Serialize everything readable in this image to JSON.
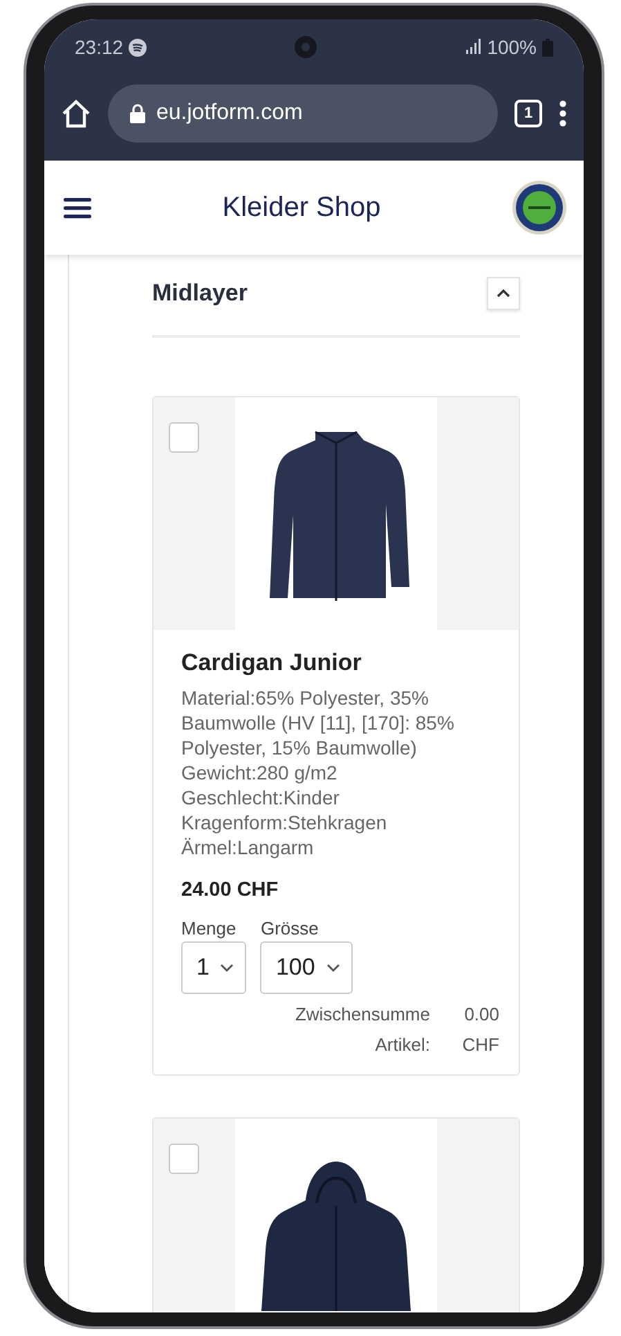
{
  "status_bar": {
    "time": "23:12",
    "battery": "100%"
  },
  "browser": {
    "url": "eu.jotform.com",
    "tab_count": "1"
  },
  "header": {
    "title": "Kleider Shop"
  },
  "section": {
    "title": "Midlayer",
    "expanded": true
  },
  "products": [
    {
      "kind": "cardigan",
      "selected": false,
      "name": "Cardigan Junior",
      "description": "Material:65% Polyester, 35% Baumwolle (HV [11], [170]: 85% Polyester, 15% Baumwolle) Gewicht:280 g/m2 Geschlecht:Kinder Kragenform:Stehkragen Ärmel:Langarm",
      "price": "24.00 CHF",
      "quantity_label": "Menge",
      "quantity": "1",
      "size_label": "Grösse",
      "size": "100",
      "subtotal_label": "Zwischensumme Artikel:",
      "subtotal": "0.00 CHF"
    },
    {
      "kind": "hoodie",
      "selected": false
    }
  ]
}
